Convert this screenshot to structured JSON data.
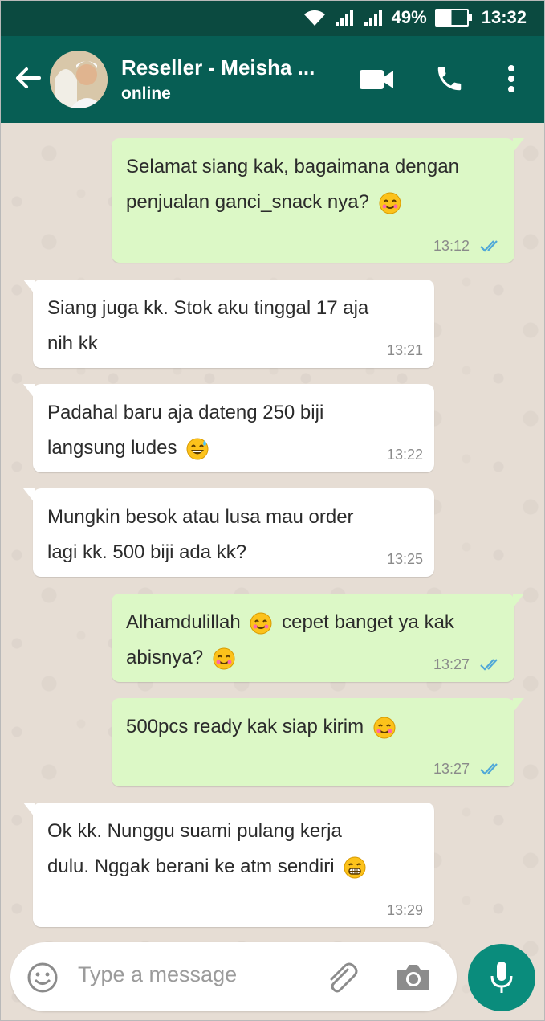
{
  "status_bar": {
    "battery": "49%",
    "time": "13:32"
  },
  "header": {
    "contact_name": "Reseller - Meisha ...",
    "contact_status": "online"
  },
  "messages": [
    {
      "direction": "outgoing",
      "lines": [
        "Selamat siang kak, bagaimana dengan",
        "penjualan ganci_snack nya?"
      ],
      "time": "13:12",
      "read": true,
      "emoji": "smile"
    },
    {
      "direction": "incoming",
      "lines": [
        "Siang juga kk. Stok aku tinggal 17 aja",
        "nih kk"
      ],
      "time": "13:21"
    },
    {
      "direction": "incoming",
      "lines": [
        "Padahal baru aja dateng 250 biji",
        "langsung ludes"
      ],
      "time": "13:22",
      "emoji": "sweat-smile"
    },
    {
      "direction": "incoming",
      "lines": [
        "Mungkin besok atau lusa mau order",
        "lagi kk. 500 biji ada kk?"
      ],
      "time": "13:25"
    },
    {
      "direction": "outgoing",
      "lines": [
        "Alhamdulillah",
        "cepet banget ya kak",
        "abisnya?"
      ],
      "time": "13:27",
      "read": true,
      "emoji": "smile"
    },
    {
      "direction": "outgoing",
      "lines": [
        "500pcs ready kak siap kirim"
      ],
      "time": "13:27",
      "read": true,
      "emoji": "smile"
    },
    {
      "direction": "incoming",
      "lines": [
        "Ok kk. Nunggu suami pulang kerja",
        "dulu. Nggak berani ke atm sendiri"
      ],
      "time": "13:29",
      "emoji": "grin"
    }
  ],
  "input": {
    "placeholder": "Type a message"
  },
  "colors": {
    "header": "#075e54",
    "status_bar": "#0b4a40",
    "outgoing_bubble": "#dcf8c6",
    "incoming_bubble": "#ffffff",
    "mic_button": "#0a8c7c",
    "read_ticks": "#4fa8d8"
  },
  "icons": [
    "wifi-icon",
    "signal-icon",
    "battery-icon",
    "back-arrow-icon",
    "video-call-icon",
    "phone-icon",
    "more-vert-icon",
    "double-check-icon",
    "emoji-icon",
    "attach-icon",
    "camera-icon",
    "mic-icon"
  ]
}
